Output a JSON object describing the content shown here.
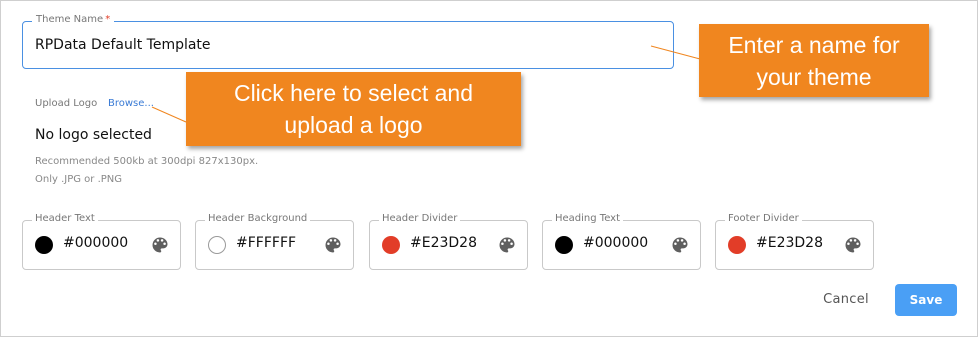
{
  "form": {
    "theme_name": {
      "label": "Theme Name",
      "required_mark": "*",
      "value": "RPData Default Template"
    },
    "upload": {
      "label": "Upload Logo",
      "browse_label": "Browse...",
      "status": "No logo selected",
      "hint_size": "Recommended 500kb at 300dpi 827x130px.",
      "hint_format": "Only .JPG or .PNG"
    },
    "colors": [
      {
        "label": "Header Text",
        "hex": "#000000",
        "swatch": "#000000"
      },
      {
        "label": "Header Background",
        "hex": "#FFFFFF",
        "swatch": "#FFFFFF"
      },
      {
        "label": "Header Divider",
        "hex": "#E23D28",
        "swatch": "#E23D28"
      },
      {
        "label": "Heading Text",
        "hex": "#000000",
        "swatch": "#000000"
      },
      {
        "label": "Footer Divider",
        "hex": "#E23D28",
        "swatch": "#E23D28"
      }
    ],
    "actions": {
      "cancel_label": "Cancel",
      "save_label": "Save"
    }
  },
  "callouts": {
    "name_line1": "Enter a name for",
    "name_line2": "your theme",
    "logo_line1": "Click here to select and",
    "logo_line2": "upload a logo"
  },
  "icons": {
    "palette": "palette-icon"
  },
  "theme_colors": {
    "accent": "#4a90e2",
    "save_button": "#4a9ff5",
    "callout": "#f0861f",
    "required": "#e23d28"
  }
}
